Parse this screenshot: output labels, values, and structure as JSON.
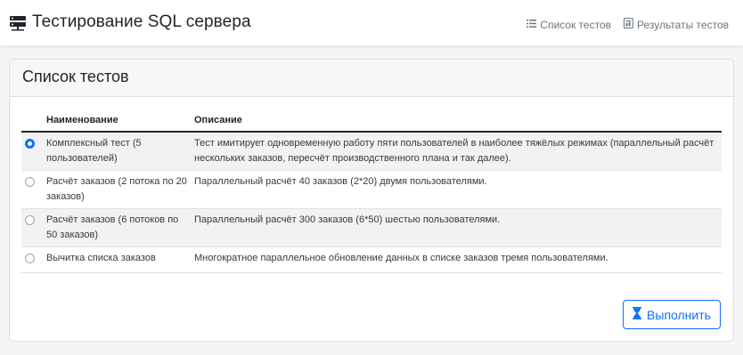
{
  "app": {
    "title": "Тестирование SQL сервера",
    "icon": "server-icon"
  },
  "nav": {
    "tests_label": "Список тестов",
    "results_label": "Результаты тестов",
    "tests_icon": "list-icon",
    "results_icon": "report-icon"
  },
  "panel": {
    "title": "Список тестов"
  },
  "table": {
    "headers": [
      "Наименование",
      "Описание"
    ],
    "rows": [
      {
        "selected": true,
        "name": "Комплексный тест (5 пользователей)",
        "description": "Тест имитирует одновременную работу пяти пользователей в наиболее тяжёлых режимах (параллельный расчёт нескольких заказов, пересчёт производственного плана и так далее)."
      },
      {
        "selected": false,
        "name": "Расчёт заказов (2 потока по 20 заказов)",
        "description": "Параллельный расчёт 40 заказов (2*20) двумя пользователями."
      },
      {
        "selected": false,
        "name": "Расчёт заказов (6 потоков по 50 заказов)",
        "description": "Параллельный расчёт 300 заказов (6*50) шестью пользователями."
      },
      {
        "selected": false,
        "name": "Вычитка списка заказов",
        "description": "Многократное параллельное обновление данных в списке заказов тремя пользователями."
      }
    ]
  },
  "actions": {
    "run_label": "Выполнить",
    "run_icon": "hourglass-icon"
  },
  "colors": {
    "accent": "#0d6efd",
    "muted": "#6c757d"
  }
}
